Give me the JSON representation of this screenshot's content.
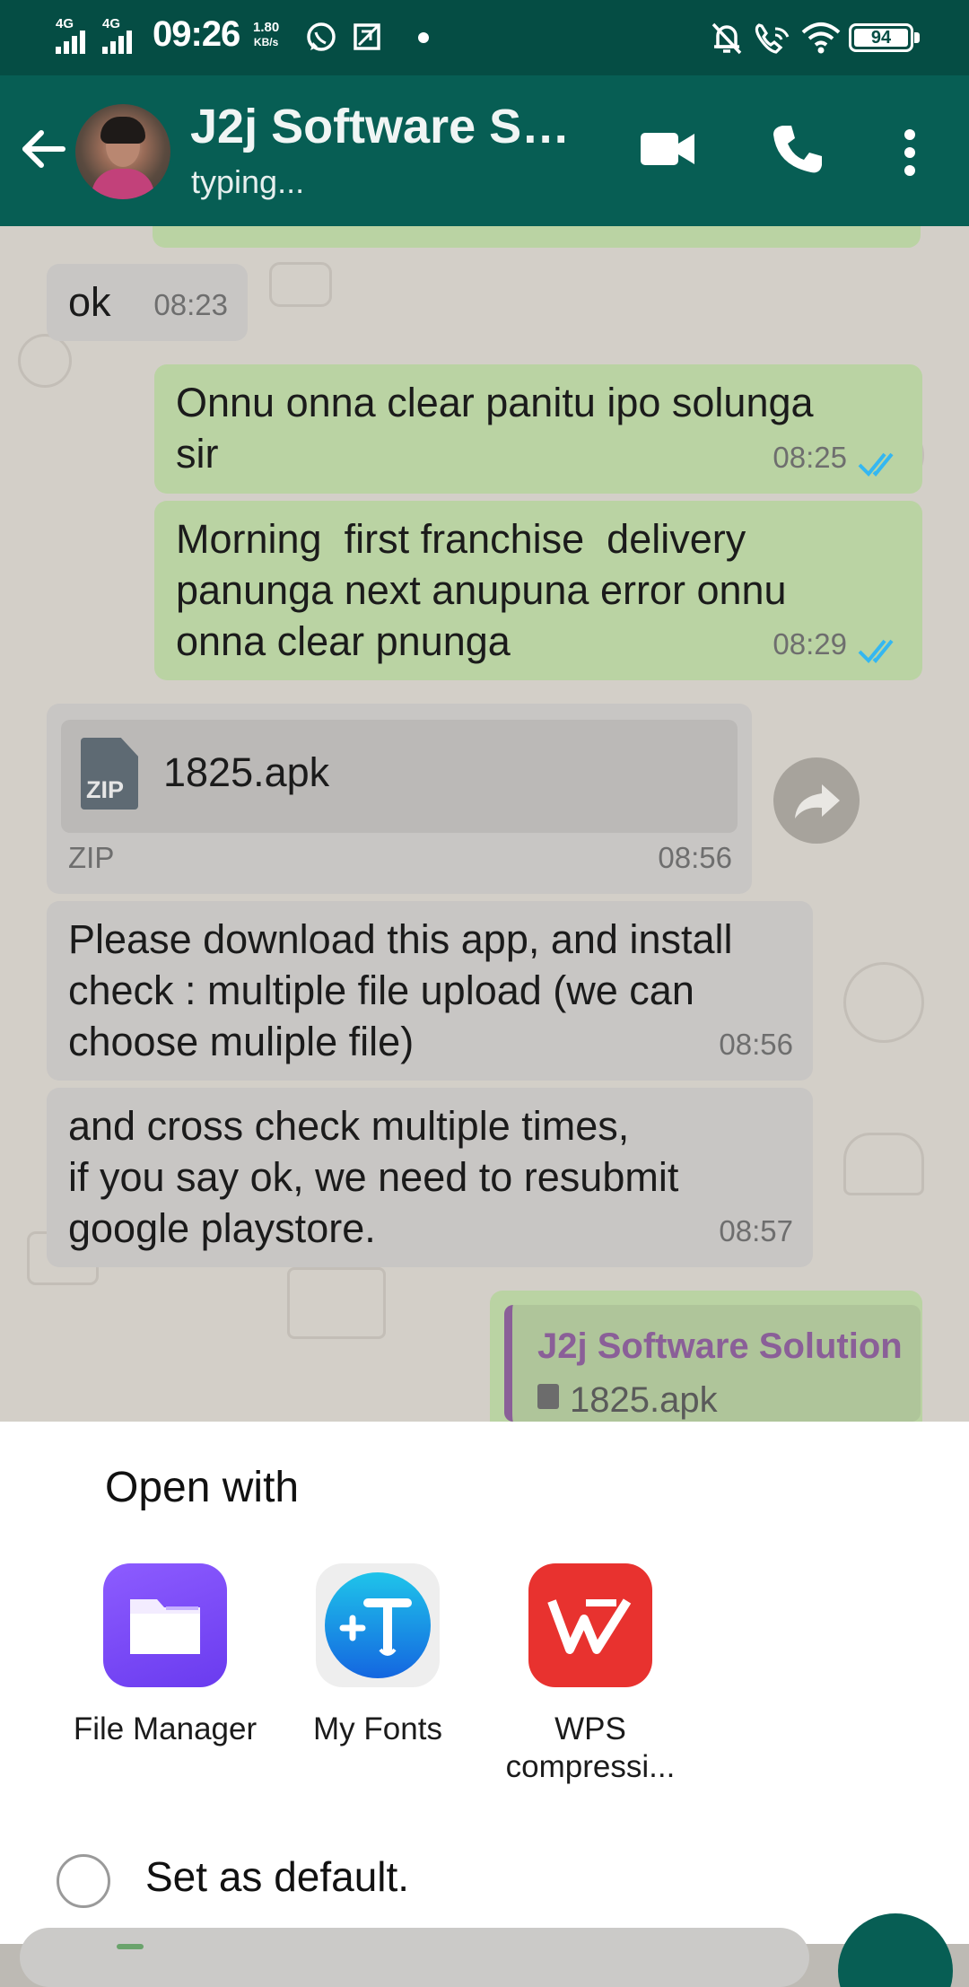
{
  "status_bar": {
    "sim1": "4G",
    "sim2": "4G",
    "time": "09:26",
    "speed_value": "1.80",
    "speed_unit": "KB/s",
    "battery": "94",
    "icons": [
      "whatsapp-icon",
      "screenshot-icon",
      "dot-icon",
      "mute-bell-icon",
      "wifi-call-icon",
      "wifi-icon",
      "battery-icon"
    ]
  },
  "app_bar": {
    "contact_name": "J2j Software Sol...",
    "status": "typing...",
    "icons": [
      "back-arrow-icon",
      "avatar",
      "video-call-icon",
      "phone-call-icon",
      "more-vert-icon"
    ]
  },
  "messages": [
    {
      "direction": "in",
      "text": "ok",
      "time": "08:23"
    },
    {
      "direction": "out",
      "text": "Onnu onna clear panitu ipo solunga\nsir",
      "time": "08:25",
      "status": "read"
    },
    {
      "direction": "out",
      "text": "Morning  first franchise  delivery\npanunga next anupuna error onnu\nonna clear pnunga",
      "time": "08:29",
      "status": "read"
    },
    {
      "direction": "in",
      "type": "file",
      "file_name": "1825.apk",
      "file_type": "ZIP",
      "icon_label": "ZIP",
      "time": "08:56"
    },
    {
      "direction": "in",
      "text": "Please download this app, and install\ncheck : multiple file upload (we can\nchoose muliple file)",
      "time": "08:56"
    },
    {
      "direction": "in",
      "text": "and cross check multiple times,\nif you say ok, we need to resubmit\ngoogle playstore.",
      "time": "08:57"
    },
    {
      "direction": "out",
      "type": "reply",
      "quote_name": "J2j Software Solution",
      "quote_file": "1825.apk"
    }
  ],
  "sheet": {
    "title": "Open with",
    "apps": [
      {
        "label": "File Manager",
        "icon": "folder-icon",
        "color": "#7b4dff"
      },
      {
        "label": "My Fonts",
        "icon": "fonts-icon",
        "color": "#1e90e8"
      },
      {
        "label": "WPS\ncompressi...",
        "icon": "wps-icon",
        "color": "#e8322f"
      }
    ],
    "default_label": "Set as default.",
    "default_checked": false
  },
  "colors": {
    "header": "#075e54",
    "status_bar": "#054d44",
    "outgoing_bubble": "#bad3a3",
    "incoming_bubble": "#c8c6c4",
    "read_ticks": "#34b7f1"
  }
}
